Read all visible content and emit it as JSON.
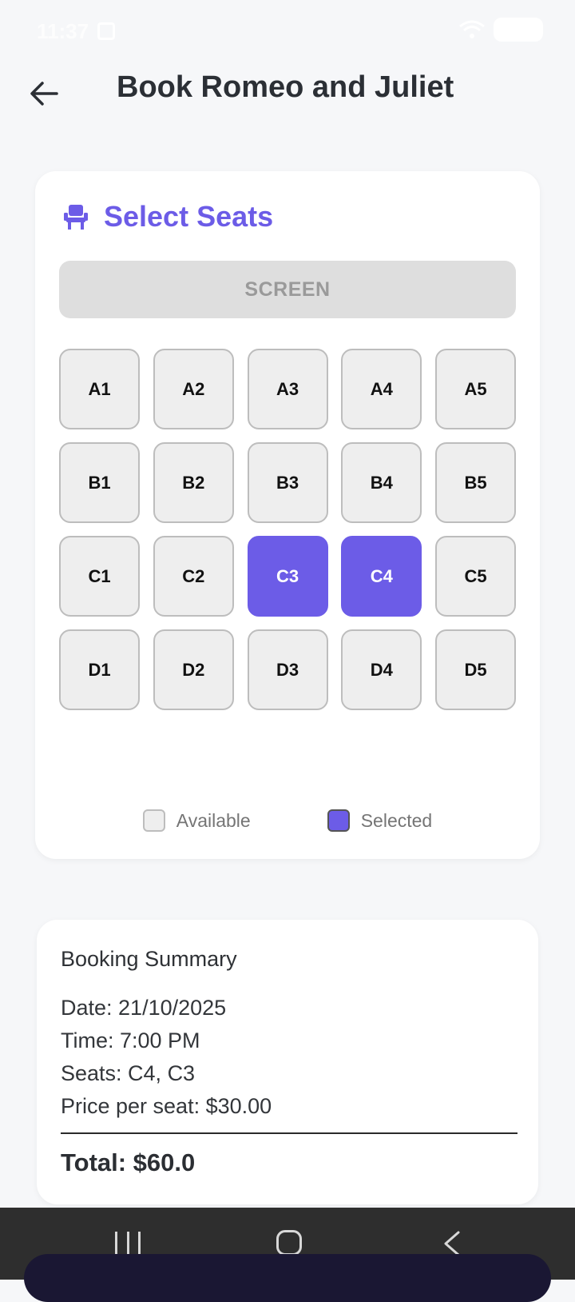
{
  "status": {
    "time": "11:37"
  },
  "header": {
    "title": "Book Romeo and Juliet",
    "back_icon": "arrow-left-icon"
  },
  "seat_card": {
    "title": "Select Seats",
    "icon": "seat-icon",
    "accent": "#6c5ce7",
    "screen_label": "SCREEN",
    "rows": [
      [
        "A1",
        "A2",
        "A3",
        "A4",
        "A5"
      ],
      [
        "B1",
        "B2",
        "B3",
        "B4",
        "B5"
      ],
      [
        "C1",
        "C2",
        "C3",
        "C4",
        "C5"
      ],
      [
        "D1",
        "D2",
        "D3",
        "D4",
        "D5"
      ]
    ],
    "selected": [
      "C3",
      "C4"
    ],
    "legend": {
      "available": "Available",
      "selected": "Selected"
    }
  },
  "summary": {
    "title": "Booking Summary",
    "date": "Date: 21/10/2025",
    "time": "Time: 7:00 PM",
    "seats": "Seats: C4, C3",
    "price": "Price per seat: $30.00",
    "total": "Total: $60.0"
  },
  "nav": {
    "recent_icon": "recent-apps-icon",
    "home_icon": "home-icon",
    "back_icon": "back-chevron-icon"
  }
}
